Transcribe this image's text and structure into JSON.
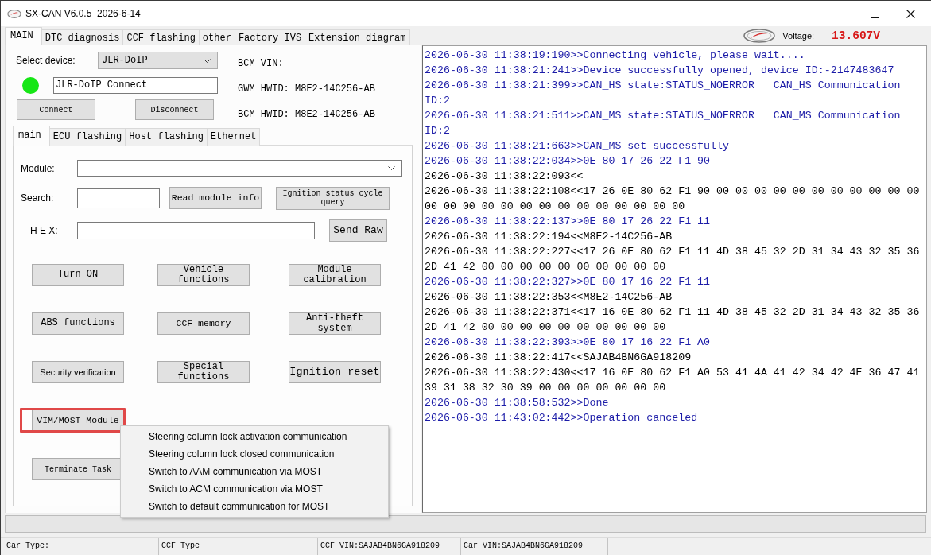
{
  "window": {
    "title": "SX-CAN V6.0.5  2026-6-14"
  },
  "tabs": [
    {
      "label": "MAIN",
      "selected": true
    },
    {
      "label": "DTC diagnosis",
      "selected": false
    },
    {
      "label": "CCF flashing",
      "selected": false
    },
    {
      "label": "other",
      "selected": false
    },
    {
      "label": "Factory IVS",
      "selected": false
    },
    {
      "label": "Extension diagram",
      "selected": false
    }
  ],
  "voltage": {
    "label": "Voltage:",
    "value": "13.607V"
  },
  "main": {
    "device": {
      "label": "Select device:",
      "value": "JLR-DoIP"
    },
    "connection": {
      "connected": true,
      "text": "JLR-DoIP Connect"
    },
    "connection_buttons": [
      "Connect",
      "Disconnect"
    ],
    "vehicle_info": [
      "BCM VIN:",
      "GWM HWID: M8E2-14C256-AB",
      "BCM HWID: M8E2-14C256-AB"
    ],
    "sub_tabs": [
      {
        "label": "main",
        "selected": true
      },
      {
        "label": "ECU flashing",
        "selected": false
      },
      {
        "label": "Host flashing",
        "selected": false
      },
      {
        "label": "Ethernet",
        "selected": false
      }
    ],
    "module": {
      "label": "Module:"
    },
    "search": {
      "label": "Search:",
      "buttons": [
        "Read module info",
        "Ignition status cycle query"
      ]
    },
    "hex": {
      "label": "H E X:",
      "button": "Send Raw"
    },
    "function_buttons": [
      [
        {
          "label": "Turn ON",
          "highlighted": false
        },
        {
          "label": "Vehicle functions",
          "highlighted": false
        },
        {
          "label": "Module calibration",
          "highlighted": false
        }
      ],
      [
        {
          "label": "ABS functions",
          "highlighted": false
        },
        {
          "label": "CCF memory",
          "highlighted": false
        },
        {
          "label": "Anti-theft system",
          "highlighted": false
        }
      ],
      [
        {
          "label": "Security verification",
          "highlighted": false
        },
        {
          "label": "Special functions",
          "highlighted": false
        },
        {
          "label": "Ignition reset",
          "highlighted": false
        }
      ],
      [
        {
          "label": "VIM/MOST Module",
          "highlighted": true
        }
      ],
      [
        {
          "label": "Terminate Task",
          "highlighted": false
        }
      ]
    ],
    "context_menu": {
      "items": [
        "Steering column lock activation communication",
        "Steering column lock closed communication",
        "Switch to AAM communication via MOST",
        "Switch to ACM communication via MOST",
        "Switch to default communication for MOST"
      ]
    }
  },
  "log": [
    {
      "kind": "sent",
      "text": "2026-06-30 11:38:19:190>>Connecting vehicle, please wait...."
    },
    {
      "kind": "sent",
      "text": "2026-06-30 11:38:21:241>>Device successfully opened, device ID:-2147483647"
    },
    {
      "kind": "sent",
      "text": "2026-06-30 11:38:21:399>>CAN_HS state:STATUS_NOERROR   CAN_HS Communication ID:2"
    },
    {
      "kind": "sent",
      "text": "2026-06-30 11:38:21:511>>CAN_MS state:STATUS_NOERROR   CAN_MS Communication ID:2"
    },
    {
      "kind": "sent",
      "text": "2026-06-30 11:38:21:663>>CAN_MS set successfully"
    },
    {
      "kind": "sent",
      "text": "2026-06-30 11:38:22:034>>0E 80 17 26 22 F1 90"
    },
    {
      "kind": "received",
      "text": "2026-06-30 11:38:22:093<<"
    },
    {
      "kind": "received",
      "text": "2026-06-30 11:38:22:108<<17 26 0E 80 62 F1 90 00 00 00 00 00 00 00 00 00 00 00 00 00 00 00 00 00 00 00 00 00 00 00 00 00"
    },
    {
      "kind": "sent",
      "text": "2026-06-30 11:38:22:137>>0E 80 17 26 22 F1 11"
    },
    {
      "kind": "received",
      "text": "2026-06-30 11:38:22:194<<M8E2-14C256-AB"
    },
    {
      "kind": "received",
      "text": "2026-06-30 11:38:22:227<<17 26 0E 80 62 F1 11 4D 38 45 32 2D 31 34 43 32 35 36 2D 41 42 00 00 00 00 00 00 00 00 00 00"
    },
    {
      "kind": "sent",
      "text": "2026-06-30 11:38:22:327>>0E 80 17 16 22 F1 11"
    },
    {
      "kind": "received",
      "text": "2026-06-30 11:38:22:353<<M8E2-14C256-AB"
    },
    {
      "kind": "received",
      "text": "2026-06-30 11:38:22:371<<17 16 0E 80 62 F1 11 4D 38 45 32 2D 31 34 43 32 35 36 2D 41 42 00 00 00 00 00 00 00 00 00 00"
    },
    {
      "kind": "sent",
      "text": "2026-06-30 11:38:22:393>>0E 80 17 16 22 F1 A0"
    },
    {
      "kind": "received",
      "text": "2026-06-30 11:38:22:417<<SAJAB4BN6GA918209"
    },
    {
      "kind": "received",
      "text": "2026-06-30 11:38:22:430<<17 16 0E 80 62 F1 A0 53 41 4A 41 42 34 42 4E 36 47 41 39 31 38 32 30 39 00 00 00 00 00 00 00"
    },
    {
      "kind": "sent",
      "text": "2026-06-30 11:38:58:532>>Done"
    },
    {
      "kind": "sent",
      "text": "2026-06-30 11:43:02:442>>Operation canceled"
    }
  ],
  "status_bar": [
    "Car Type:",
    "CCF Type",
    "CCF VIN:SAJAB4BN6GA918209",
    "Car VIN:SAJAB4BN6GA918209"
  ]
}
